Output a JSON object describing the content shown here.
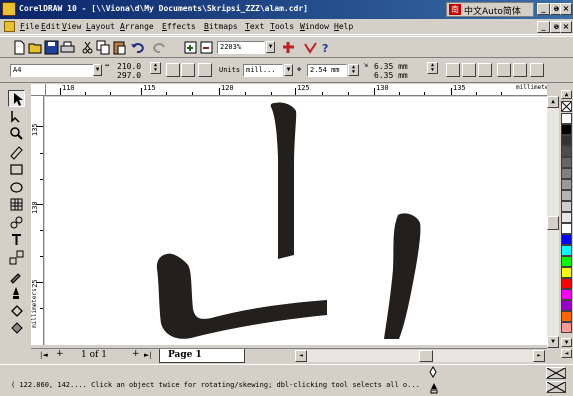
{
  "window": {
    "title": "CorelDRAW 10 - [\\\\Viona\\d\\My Documents\\Skripsi_ZZZ\\alam.cdr]",
    "ime_text": "中文Auto简体",
    "ime_logo": "南",
    "min": "_",
    "restore": "ə",
    "close": "×"
  },
  "menu": {
    "items": [
      "File",
      "Edit",
      "View",
      "Layout",
      "Arrange",
      "Effects",
      "Bitmaps",
      "Text",
      "Tools",
      "Window",
      "Help"
    ]
  },
  "toolbar": {
    "zoom": "2203%"
  },
  "propbar": {
    "paper_size": "A4",
    "width": "210.0",
    "height": "297.0",
    "units_label": "Units",
    "units_value": "mill...",
    "nudge": "2.54 mm",
    "dup_x": "6.35 mm",
    "dup_y": "6.35 mm"
  },
  "ruler": {
    "h_labels": [
      "110",
      "115",
      "120",
      "125",
      "130",
      "135"
    ],
    "v_labels": [
      "135",
      "130",
      "125"
    ],
    "units": "millimeters"
  },
  "pages": {
    "counter": "1 of 1",
    "tab_label": "Page 1"
  },
  "status": {
    "text": "( 122.860, 142....  Click an object twice for rotating/skewing; dbl-clicking tool selects all o..."
  },
  "palette": {
    "colors": [
      "#ffffff",
      "#000000",
      "#333333",
      "#4d4d4d",
      "#666666",
      "#808080",
      "#999999",
      "#b3b3b3",
      "#cccccc",
      "#e6e6e6",
      "#ffffff",
      "#0000ff",
      "#00ffff",
      "#00ff00",
      "#ffff00",
      "#ff0000",
      "#ff00ff",
      "#9900cc",
      "#ff6600",
      "#ff9999"
    ]
  },
  "icons": {
    "toolbar": [
      "new-icon",
      "open-icon",
      "save-icon",
      "print-icon",
      "cut-icon",
      "copy-icon",
      "paste-icon",
      "undo-icon",
      "redo-icon",
      "import-icon",
      "export-icon",
      "zoom-level-icon",
      "application-launcher-icon",
      "help-icon"
    ],
    "tools": [
      "pick-tool-icon",
      "shape-tool-icon",
      "zoom-tool-icon",
      "freehand-tool-icon",
      "rectangle-tool-icon",
      "ellipse-tool-icon",
      "graph-paper-tool-icon",
      "basic-shapes-tool-icon",
      "text-tool-icon",
      "interactive-fill-icon",
      "eyedropper-tool-icon",
      "outline-tool-icon",
      "fill-tool-icon",
      "interactive-fill-tool-icon"
    ]
  }
}
